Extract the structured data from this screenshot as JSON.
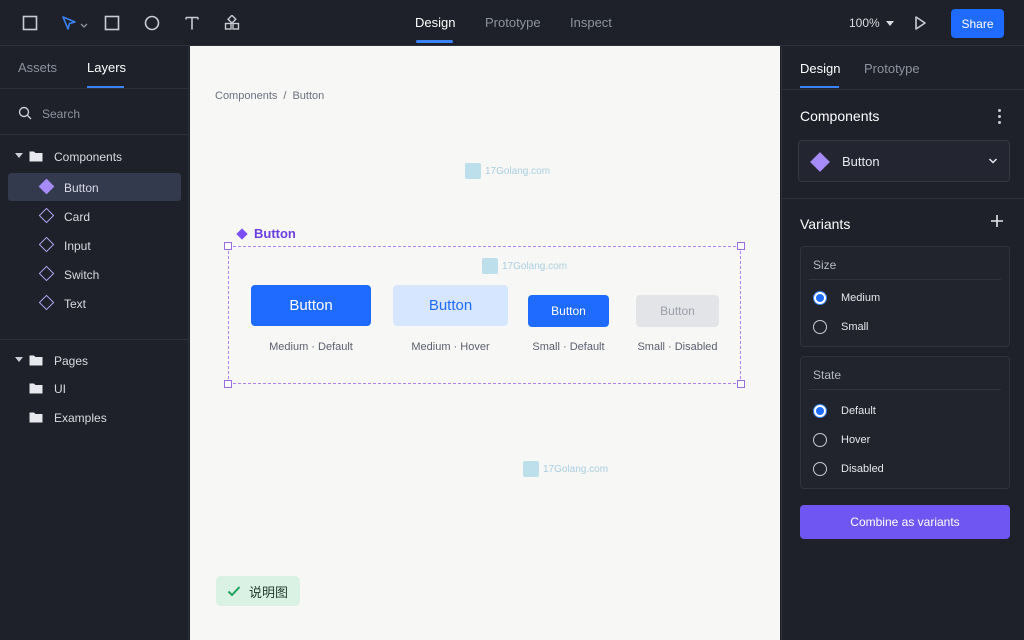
{
  "toolbar": {
    "tools": [
      "frame-tool",
      "move-tool",
      "rectangle-tool",
      "ellipse-tool",
      "text-tool",
      "components-tool"
    ],
    "mode_tabs": [
      {
        "label": "Design",
        "active": true
      },
      {
        "label": "Prototype",
        "active": false
      },
      {
        "label": "Inspect",
        "active": false
      }
    ],
    "zoom": "100%",
    "share_label": "Share"
  },
  "left_panel": {
    "tabs": [
      {
        "label": "Assets",
        "active": false
      },
      {
        "label": "Layers",
        "active": true
      }
    ],
    "search_placeholder": "Search",
    "components_group": "Components",
    "component_items": [
      "Button",
      "Card",
      "Input",
      "Switch",
      "Text"
    ],
    "pages_group": "Pages",
    "page_items": [
      "UI",
      "Examples"
    ]
  },
  "canvas": {
    "breadcrumb": [
      "Components",
      "/",
      "Button"
    ],
    "frame_label": "Button",
    "buttons": [
      {
        "label": "Button",
        "caption": "Medium · Default"
      },
      {
        "label": "Button",
        "caption": "Medium · Hover"
      },
      {
        "label": "Button",
        "caption": "Small · Default"
      },
      {
        "label": "Button",
        "caption": "Small · Disabled"
      }
    ],
    "badge": "说明图",
    "watermark": "17Golang.com"
  },
  "right_panel": {
    "tabs": [
      {
        "label": "Design",
        "active": true
      },
      {
        "label": "Prototype",
        "active": false
      }
    ],
    "components_heading": "Components",
    "component_selected": "Button",
    "variants_heading": "Variants",
    "size_title": "Size",
    "size_options": [
      {
        "label": "Medium",
        "selected": true
      },
      {
        "label": "Small",
        "selected": false
      }
    ],
    "state_title": "State",
    "state_options": [
      {
        "label": "Default",
        "selected": true
      },
      {
        "label": "Hover",
        "selected": false
      },
      {
        "label": "Disabled",
        "selected": false
      }
    ],
    "combine_label": "Combine as variants"
  },
  "colors": {
    "accent": "#1f6bff",
    "component_purple": "#a78bfa",
    "combine_purple": "#6f56f2",
    "panel_bg": "#1e2129",
    "canvas_bg": "#f7f7f5"
  }
}
